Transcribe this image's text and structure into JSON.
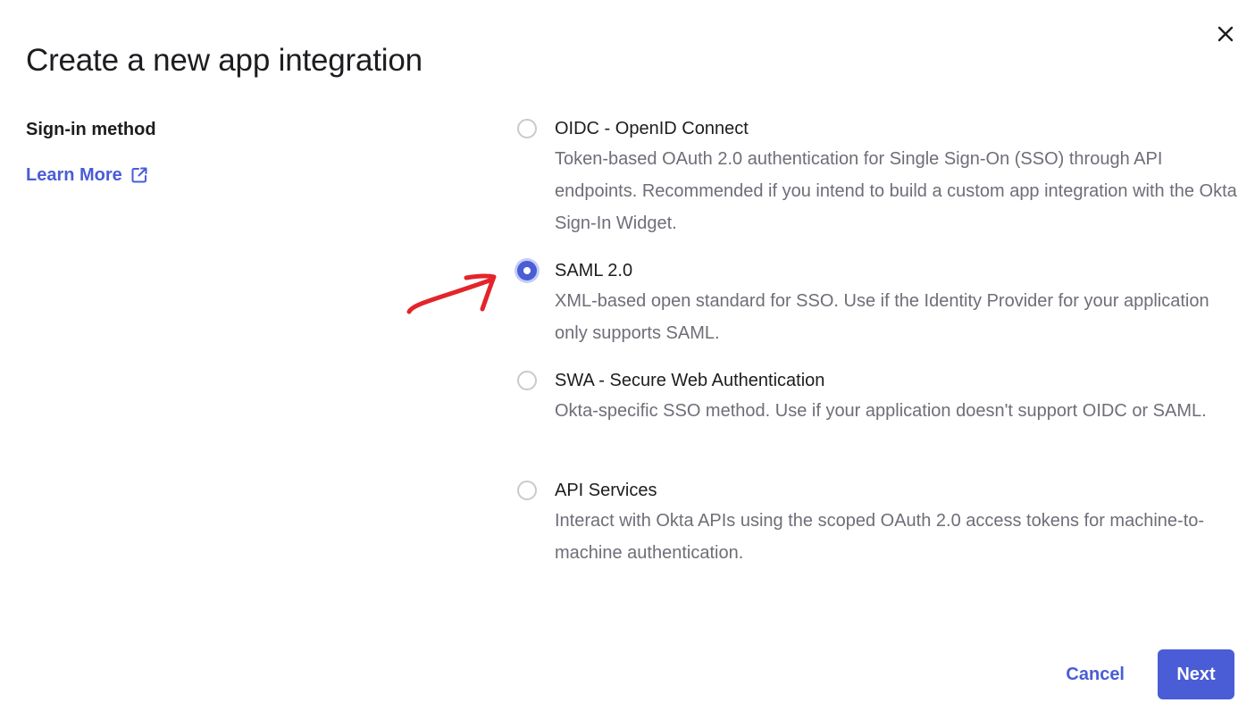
{
  "dialog": {
    "title": "Create a new app integration",
    "close_icon": "close-icon"
  },
  "sign_in": {
    "label": "Sign-in method",
    "learn_more": "Learn More",
    "learn_more_icon": "external-link-icon"
  },
  "options": [
    {
      "title": "OIDC - OpenID Connect",
      "description": "Token-based OAuth 2.0 authentication for Single Sign-On (SSO) through API endpoints. Recommended if you intend to build a custom app integration with the Okta Sign-In Widget.",
      "selected": false
    },
    {
      "title": "SAML 2.0",
      "description": "XML-based open standard for SSO. Use if the Identity Provider for your application only supports SAML.",
      "selected": true
    },
    {
      "title": "SWA - Secure Web Authentication",
      "description": "Okta-specific SSO method. Use if your application doesn't support OIDC or SAML.",
      "selected": false
    },
    {
      "title": "API Services",
      "description": "Interact with Okta APIs using the scoped OAuth 2.0 access tokens for machine-to-machine authentication.",
      "selected": false
    }
  ],
  "footer": {
    "cancel_label": "Cancel",
    "next_label": "Next"
  },
  "colors": {
    "accent": "#4a5cd6",
    "annotation_arrow": "#e3242b"
  }
}
